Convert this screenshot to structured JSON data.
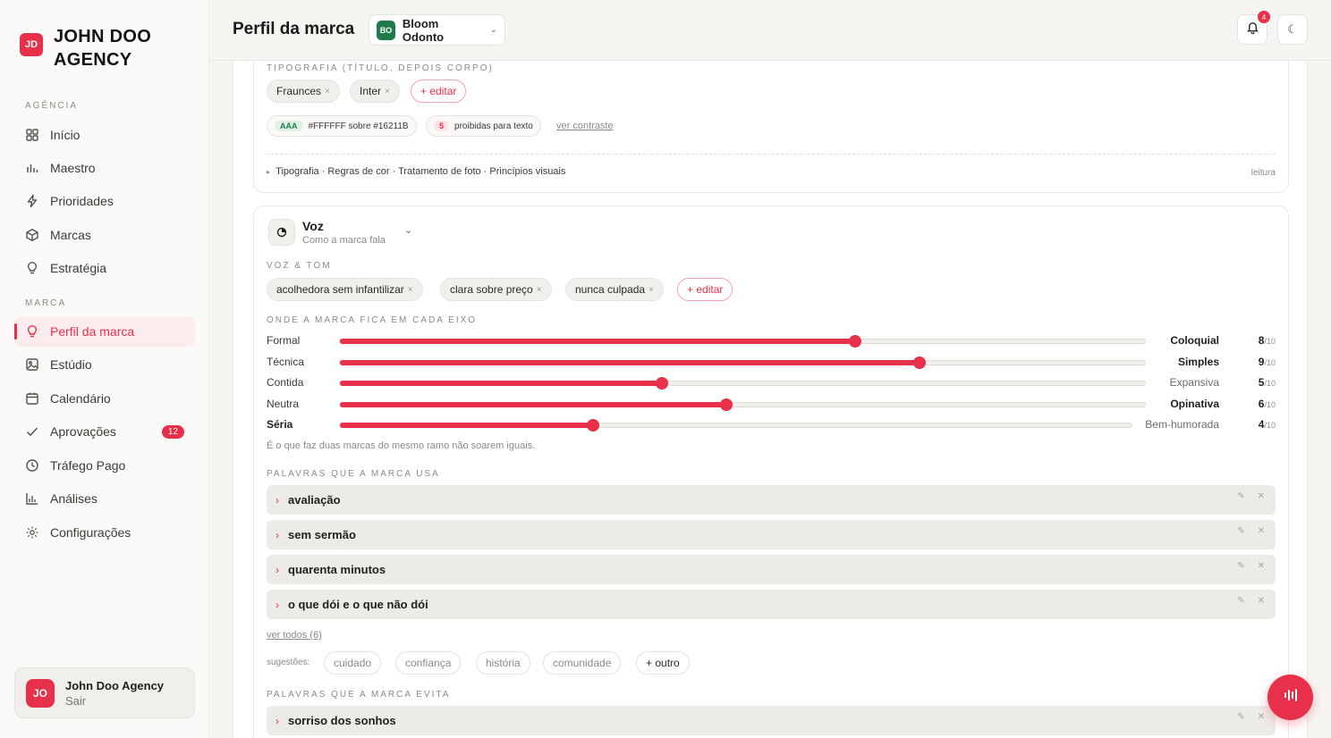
{
  "sidebar": {
    "logo_badge": "JD",
    "logo_text": "JOHN DOO AGENCY",
    "section_agencia": "AGÊNCIA",
    "section_marca": "MARCA",
    "items": [
      {
        "label": "Início",
        "icon": "grid-icon"
      },
      {
        "label": "Maestro",
        "icon": "bars-icon"
      },
      {
        "label": "Prioridades",
        "icon": "bolt-icon"
      },
      {
        "label": "Marcas",
        "icon": "box-icon"
      },
      {
        "label": "Estratégia",
        "icon": "bulb-icon"
      },
      {
        "label": "Perfil da marca",
        "icon": "bulb-icon",
        "active": true
      },
      {
        "label": "Estúdio",
        "icon": "image-icon"
      },
      {
        "label": "Calendário",
        "icon": "calendar-icon"
      },
      {
        "label": "Aprovações",
        "icon": "check-icon",
        "badge": "12"
      },
      {
        "label": "Tráfego Pago",
        "icon": "clock-icon"
      },
      {
        "label": "Análises",
        "icon": "chart-icon"
      },
      {
        "label": "Configurações",
        "icon": "gear-icon"
      }
    ],
    "user": {
      "avatar": "JO",
      "name": "John Doo Agency",
      "action": "Sair"
    }
  },
  "header": {
    "title": "Perfil da marca",
    "brand_badge": "BO",
    "brand_name": "Bloom Odonto",
    "notif_count": "4"
  },
  "typography": {
    "label": "TIPOGRAFIA (TÍTULO, DEPOIS CORPO)",
    "fonts": [
      "Fraunces",
      "Inter"
    ],
    "edit": "+ editar",
    "contrast_badge": "AAA",
    "contrast_text": "#FFFFFF sobre #16211B",
    "prohibited_count": "5",
    "prohibited_text": "proibidas para texto",
    "contrast_link": "ver contraste",
    "summary": "Tipografia · Regras de cor · Tratamento de foto · Princípios visuais",
    "mode": "leitura"
  },
  "voz": {
    "title": "Voz",
    "subtitle": "Como a marca fala",
    "tone_label": "VOZ & TOM",
    "tones": [
      "acolhedora sem infantilizar",
      "clara sobre preço",
      "nunca culpada"
    ],
    "edit": "+ editar",
    "axis_label": "ONDE A MARCA FICA EM CADA EIXO",
    "axes": [
      {
        "left": "Formal",
        "right": "Coloquial",
        "value": 8,
        "display": "8",
        "den": "/10"
      },
      {
        "left": "Técnica",
        "right": "Simples",
        "value": 9,
        "display": "9",
        "den": "/10"
      },
      {
        "left": "Contida",
        "right": "Expansiva",
        "value": 5,
        "display": "5",
        "den": "/10"
      },
      {
        "left": "Neutra",
        "right": "Opinativa",
        "value": 6,
        "display": "6",
        "den": "/10"
      },
      {
        "left": "Séria",
        "right": "Bem-humorada",
        "value": 4,
        "display": "4",
        "den": "/10"
      }
    ],
    "axis_hint": "É o que faz duas marcas do mesmo ramo não soarem iguais.",
    "uses_label": "PALAVRAS QUE A MARCA USA",
    "uses": [
      "avaliação",
      "sem sermão",
      "quarenta minutos",
      "o que dói e o que não dói"
    ],
    "see_all": "ver todos (6)",
    "suggestions_label": "sugestões:",
    "suggestions": [
      "cuidado",
      "confiança",
      "história",
      "comunidade"
    ],
    "other": "+ outro",
    "avoid_label": "PALAVRAS QUE A MARCA EVITA",
    "avoid": [
      "sorriso dos sonhos"
    ]
  },
  "colors": {
    "accent": "#e8304a",
    "brand_green": "#1f7a4d"
  }
}
